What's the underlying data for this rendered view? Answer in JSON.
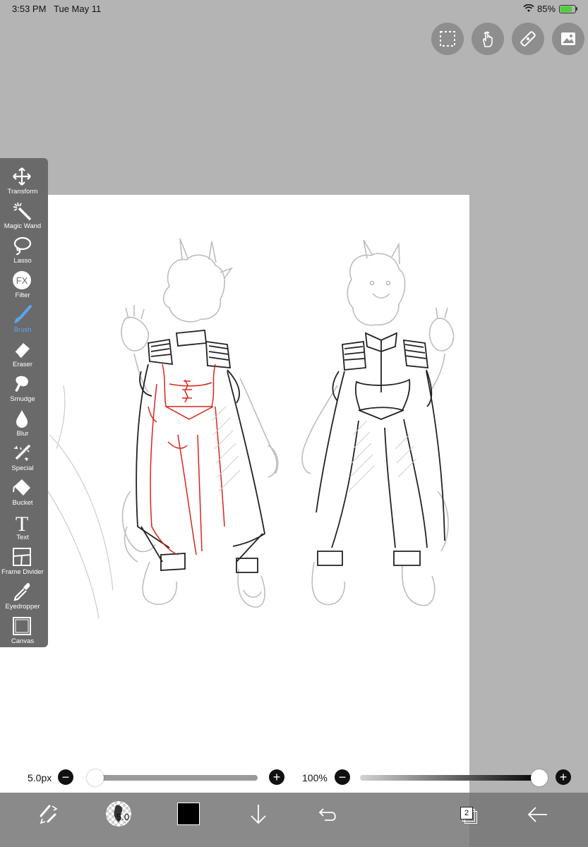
{
  "status_bar": {
    "time": "3:53 PM",
    "date": "Tue May 11",
    "battery": "85%"
  },
  "top_buttons": [
    "selection-icon",
    "touch-gesture-icon",
    "ruler-icon",
    "image-icon"
  ],
  "tools": [
    {
      "id": "transform",
      "label": "Transform",
      "icon": "transform-arrows-icon"
    },
    {
      "id": "magic-wand",
      "label": "Magic Wand",
      "icon": "magic-wand-icon"
    },
    {
      "id": "lasso",
      "label": "Lasso",
      "icon": "lasso-icon"
    },
    {
      "id": "filter",
      "label": "Filter",
      "icon": "fx-icon",
      "glyph": "FX"
    },
    {
      "id": "brush",
      "label": "Brush",
      "icon": "brush-icon",
      "active": true
    },
    {
      "id": "eraser",
      "label": "Eraser",
      "icon": "eraser-icon"
    },
    {
      "id": "smudge",
      "label": "Smudge",
      "icon": "smudge-icon"
    },
    {
      "id": "blur",
      "label": "Blur",
      "icon": "blur-drop-icon"
    },
    {
      "id": "special",
      "label": "Special",
      "icon": "special-brush-icon"
    },
    {
      "id": "bucket",
      "label": "Bucket",
      "icon": "bucket-icon"
    },
    {
      "id": "text",
      "label": "Text",
      "icon": "text-icon",
      "glyph": "T"
    },
    {
      "id": "frame-divider",
      "label": "Frame Divider",
      "icon": "frame-divider-icon"
    },
    {
      "id": "eyedropper",
      "label": "Eyedropper",
      "icon": "eyedropper-icon"
    },
    {
      "id": "canvas",
      "label": "Canvas",
      "icon": "canvas-icon"
    }
  ],
  "brush_size": {
    "value_label": "5.0px",
    "level": 0.02
  },
  "opacity": {
    "value_label": "100%",
    "level": 1.0
  },
  "bottom_bar": {
    "brush_size_badge": "5.0",
    "current_color": "#000000",
    "layer_count": "2"
  },
  "colors": {
    "toolbar": "#6a6a6a",
    "accent": "#5aa5f0",
    "sketch_red": "#d9251c"
  }
}
